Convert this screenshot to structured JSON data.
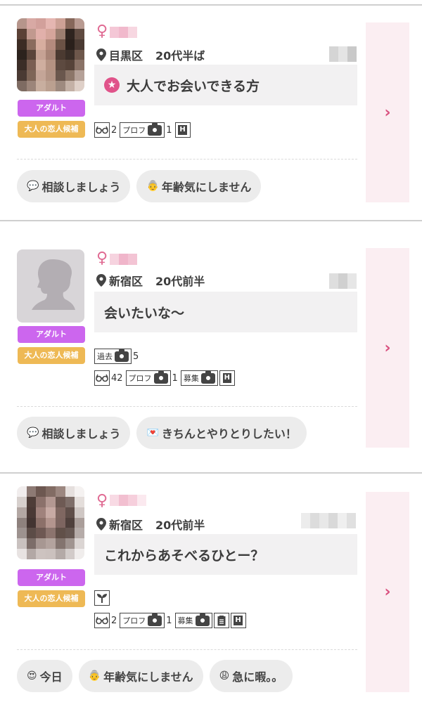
{
  "posts": [
    {
      "gender_symbol": "♀",
      "area": "目黒区",
      "age": "20代半ば",
      "message": "大人でお会いできる方",
      "message_icon": "star-icon",
      "badges": [
        "アダルト",
        "大人の恋人候補"
      ],
      "tags": {
        "eyes_count": "2",
        "profile_label": "プロフ",
        "profile_count": "1",
        "h_label": "H"
      },
      "pills": [
        {
          "emoji": "💬",
          "label": "相談しましょう"
        },
        {
          "emoji": "👵",
          "label": "年齢気にしません"
        }
      ],
      "chevron": "›"
    },
    {
      "gender_symbol": "♀",
      "area": "新宿区",
      "age": "20代前半",
      "message": "会いたいな〜",
      "badges": [
        "アダルト",
        "大人の恋人候補"
      ],
      "tags": {
        "past_label": "過去",
        "past_count": "5",
        "eyes_count": "42",
        "profile_label": "プロフ",
        "profile_count": "1",
        "recruit_label": "募集",
        "h_label": "H"
      },
      "pills": [
        {
          "emoji": "💬",
          "label": "相談しましょう"
        },
        {
          "emoji": "💌",
          "label": "きちんとやりとりしたい！"
        }
      ],
      "chevron": "›"
    },
    {
      "gender_symbol": "♀",
      "area": "新宿区",
      "age": "20代前半",
      "message": "これからあそべるひとー？",
      "badges": [
        "アダルト",
        "大人の恋人候補"
      ],
      "tags": {
        "sprout_icon": "sprout-icon",
        "eyes_count": "2",
        "profile_label": "プロフ",
        "profile_count": "1",
        "recruit_label": "募集",
        "h_label": "H"
      },
      "pills": [
        {
          "emoji": "😍",
          "label": "今日"
        },
        {
          "emoji": "👵",
          "label": "年齢気にしません"
        },
        {
          "emoji": "😩",
          "label": "急に暇。。"
        }
      ],
      "chevron": "›"
    }
  ],
  "colors": {
    "accent_pink": "#e0538a",
    "badge_adult": "#cc66ee",
    "badge_lover": "#eeb955",
    "chevron_panel": "#fbeef2"
  }
}
